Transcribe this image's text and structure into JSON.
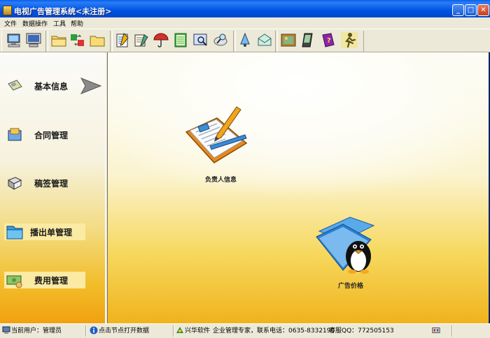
{
  "window": {
    "title": "电视广告管理系统<未注册>",
    "controls": {
      "minimize": "_",
      "maximize": "□",
      "close": "✕"
    }
  },
  "menu": {
    "items": [
      {
        "label": "文件"
      },
      {
        "label": "数据操作"
      },
      {
        "label": "工具"
      },
      {
        "label": "帮助"
      }
    ]
  },
  "toolbar": {
    "buttons": [
      "computer-icon",
      "monitor-icon",
      "folder-icon",
      "data-transfer-icon",
      "folder-yellow-icon",
      "notepad-icon",
      "edit-document-icon",
      "umbrella-icon",
      "ledger-icon",
      "search-window-icon",
      "magnifier-icon",
      "bell-icon",
      "envelope-icon",
      "picture-icon",
      "pda-icon",
      "help-book-icon",
      "exit-runner-icon"
    ]
  },
  "nav": {
    "items": [
      {
        "label": "基本信息",
        "icon": "notepad-icon",
        "selected": true
      },
      {
        "label": "合同管理",
        "icon": "contract-icon"
      },
      {
        "label": "稿签管理",
        "icon": "book-icon"
      },
      {
        "label": "播出单管理",
        "icon": "folder-icon"
      },
      {
        "label": "费用管理",
        "icon": "money-icon"
      }
    ]
  },
  "main": {
    "items": [
      {
        "label": "负责人信息",
        "icon": "notepad-pencil-icon"
      },
      {
        "label": "广告价格",
        "icon": "penguin-folder-icon"
      }
    ]
  },
  "statusbar": {
    "user": "当前用户：管理员",
    "hint": "点击节点打开数据",
    "company": "兴华软件",
    "slogan": "企业管理专家，联系电话：0635-8332190",
    "qq": "客服QQ：772505153"
  },
  "colors": {
    "titlebar": "#0058e6",
    "chrome": "#ece9d8",
    "panel_bottom": "#f1a110"
  }
}
